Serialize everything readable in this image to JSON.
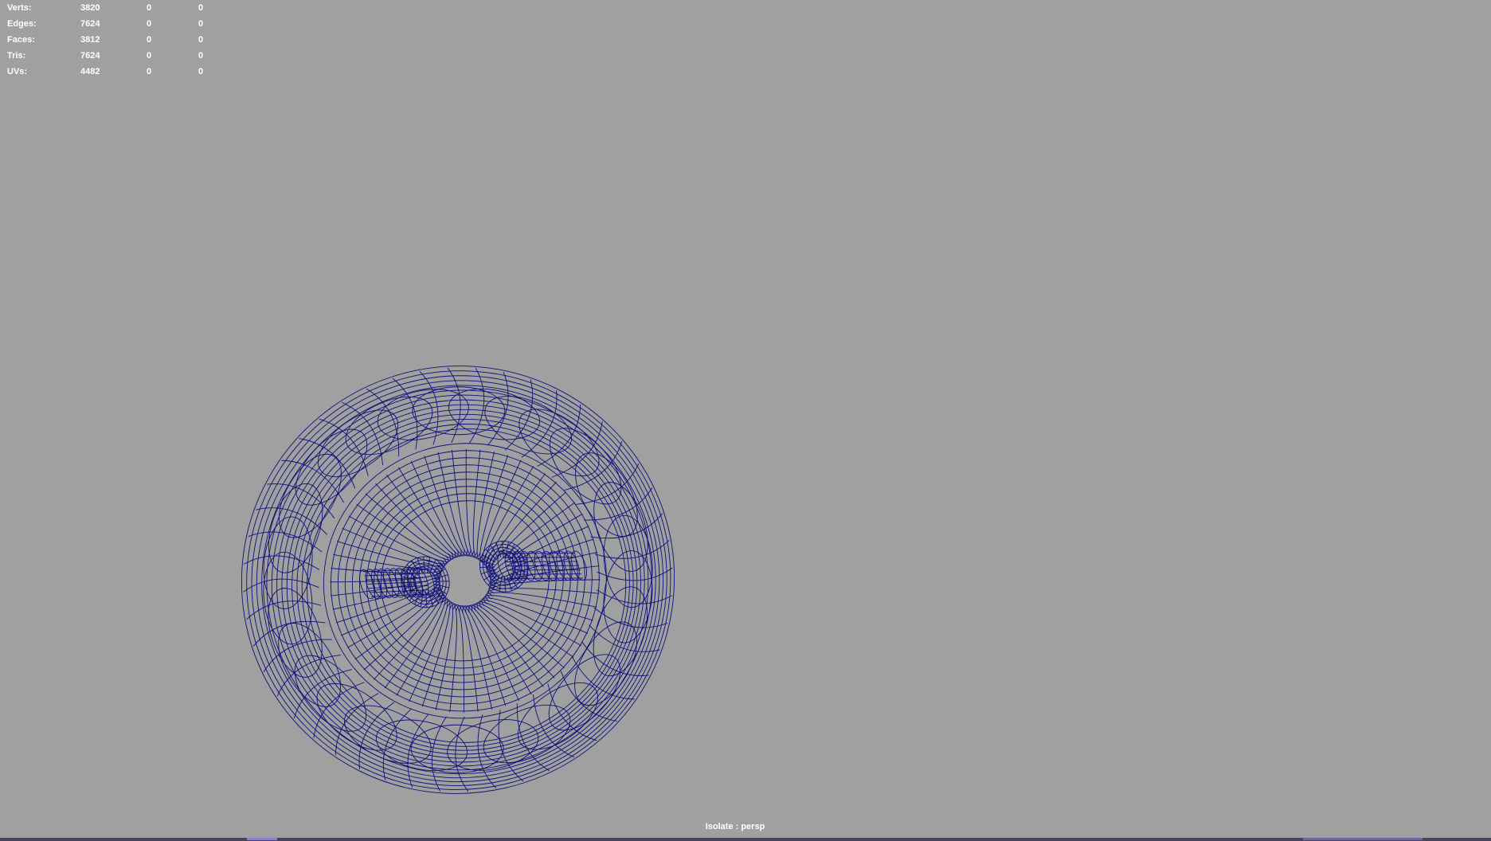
{
  "hud": {
    "rows": [
      {
        "label": "Verts:",
        "v1": "3820",
        "v2": "0",
        "v3": "0"
      },
      {
        "label": "Edges:",
        "v1": "7624",
        "v2": "0",
        "v3": "0"
      },
      {
        "label": "Faces:",
        "v1": "3812",
        "v2": "0",
        "v3": "0"
      },
      {
        "label": "Tris:",
        "v1": "7624",
        "v2": "0",
        "v3": "0"
      },
      {
        "label": "UVs:",
        "v1": "4482",
        "v2": "0",
        "v3": "0"
      }
    ]
  },
  "viewport": {
    "isolate_label": "Isolate : persp",
    "background_color": "#a0a0a0",
    "wire_color": "#0f0f7a"
  }
}
